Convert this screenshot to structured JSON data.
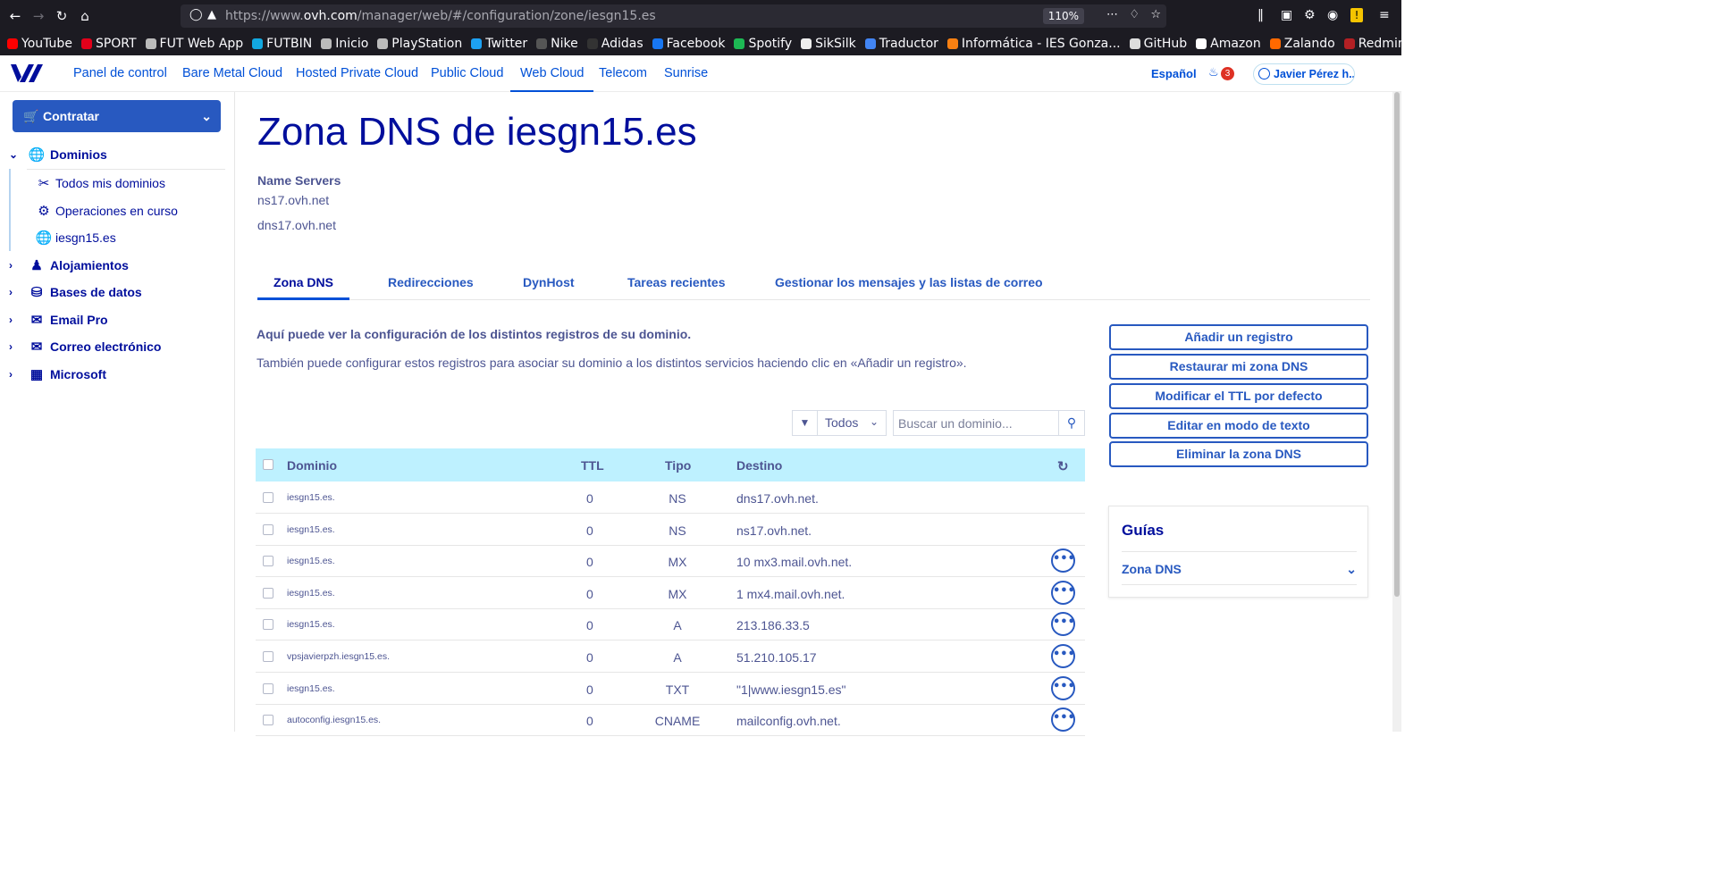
{
  "browser": {
    "url_prefix": "https://www.",
    "url_domain": "ovh.com",
    "url_path": "/manager/web/#/configuration/zone/iesgn15.es",
    "zoom": "110%"
  },
  "bookmarks": [
    {
      "label": "YouTube",
      "icon": "youtube-icon",
      "color": "#ff0000"
    },
    {
      "label": "SPORT",
      "icon": "sport-icon",
      "color": "#e2001a"
    },
    {
      "label": "FUT Web App",
      "icon": "globe-icon",
      "color": "#bbbbbb"
    },
    {
      "label": "FUTBIN",
      "icon": "futbin-icon",
      "color": "#12a8e0"
    },
    {
      "label": "Inicio",
      "icon": "globe-icon",
      "color": "#bbbbbb"
    },
    {
      "label": "PlayStation",
      "icon": "globe-icon",
      "color": "#bbbbbb"
    },
    {
      "label": "Twitter",
      "icon": "twitter-icon",
      "color": "#1da1f2"
    },
    {
      "label": "Nike",
      "icon": "nike-icon",
      "color": "#555555"
    },
    {
      "label": "Adidas",
      "icon": "adidas-icon",
      "color": "#333333"
    },
    {
      "label": "Facebook",
      "icon": "facebook-icon",
      "color": "#1877f2"
    },
    {
      "label": "Spotify",
      "icon": "spotify-icon",
      "color": "#1db954"
    },
    {
      "label": "SikSilk",
      "icon": "siksilk-icon",
      "color": "#eeeeee"
    },
    {
      "label": "Traductor",
      "icon": "translate-icon",
      "color": "#4285f4"
    },
    {
      "label": "Informática - IES Gonza...",
      "icon": "moodle-icon",
      "color": "#f98012"
    },
    {
      "label": "GitHub",
      "icon": "github-icon",
      "color": "#dddddd"
    },
    {
      "label": "Amazon",
      "icon": "amazon-icon",
      "color": "#ffffff"
    },
    {
      "label": "Zalando",
      "icon": "zalando-icon",
      "color": "#ff6900"
    },
    {
      "label": "Redmine",
      "icon": "redmine-icon",
      "color": "#b32024"
    }
  ],
  "topnav": {
    "items": [
      "Panel de control",
      "Bare Metal Cloud",
      "Hosted Private Cloud",
      "Public Cloud",
      "Web Cloud",
      "Telecom",
      "Sunrise"
    ],
    "active": "Web Cloud",
    "language": "Español",
    "notifications": "3",
    "user": "Javier Pérez h..."
  },
  "sidebar": {
    "order_button": "Contratar",
    "domains_group": "Dominios",
    "domains_items": [
      "Todos mis dominios",
      "Operaciones en curso",
      "iesgn15.es"
    ],
    "groups": [
      "Alojamientos",
      "Bases de datos",
      "Email Pro",
      "Correo electrónico",
      "Microsoft"
    ]
  },
  "main": {
    "title": "Zona DNS de iesgn15.es",
    "name_servers_label": "Name Servers",
    "name_servers": [
      "ns17.ovh.net",
      "dns17.ovh.net"
    ],
    "tabs": [
      "Zona DNS",
      "Redirecciones",
      "DynHost",
      "Tareas recientes",
      "Gestionar los mensajes y las listas de correo"
    ],
    "active_tab": "Zona DNS",
    "intro_bold": "Aquí puede ver la configuración de los distintos registros de su dominio.",
    "intro_text": "También puede configurar estos registros para asociar su dominio a los distintos servicios haciendo clic en «Añadir un registro».",
    "filter_value": "Todos",
    "search_placeholder": "Buscar un dominio...",
    "table_headers": {
      "domain": "Dominio",
      "ttl": "TTL",
      "type": "Tipo",
      "target": "Destino"
    },
    "records": [
      {
        "domain": "iesgn15.es.",
        "ttl": "0",
        "type": "NS",
        "target": "dns17.ovh.net."
      },
      {
        "domain": "iesgn15.es.",
        "ttl": "0",
        "type": "NS",
        "target": "ns17.ovh.net."
      },
      {
        "domain": "iesgn15.es.",
        "ttl": "0",
        "type": "MX",
        "target": "10 mx3.mail.ovh.net."
      },
      {
        "domain": "iesgn15.es.",
        "ttl": "0",
        "type": "MX",
        "target": "1 mx4.mail.ovh.net."
      },
      {
        "domain": "iesgn15.es.",
        "ttl": "0",
        "type": "A",
        "target": "213.186.33.5"
      },
      {
        "domain": "vpsjavierpzh.iesgn15.es.",
        "ttl": "0",
        "type": "A",
        "target": "51.210.105.17"
      },
      {
        "domain": "iesgn15.es.",
        "ttl": "0",
        "type": "TXT",
        "target": "\"1|www.iesgn15.es\""
      },
      {
        "domain": "autoconfig.iesgn15.es.",
        "ttl": "0",
        "type": "CNAME",
        "target": "mailconfig.ovh.net."
      }
    ],
    "actions": [
      "Añadir un registro",
      "Restaurar mi zona DNS",
      "Modificar el TTL por defecto",
      "Editar en modo de texto",
      "Eliminar la zona DNS"
    ],
    "guides_title": "Guías",
    "guides_item": "Zona DNS"
  }
}
